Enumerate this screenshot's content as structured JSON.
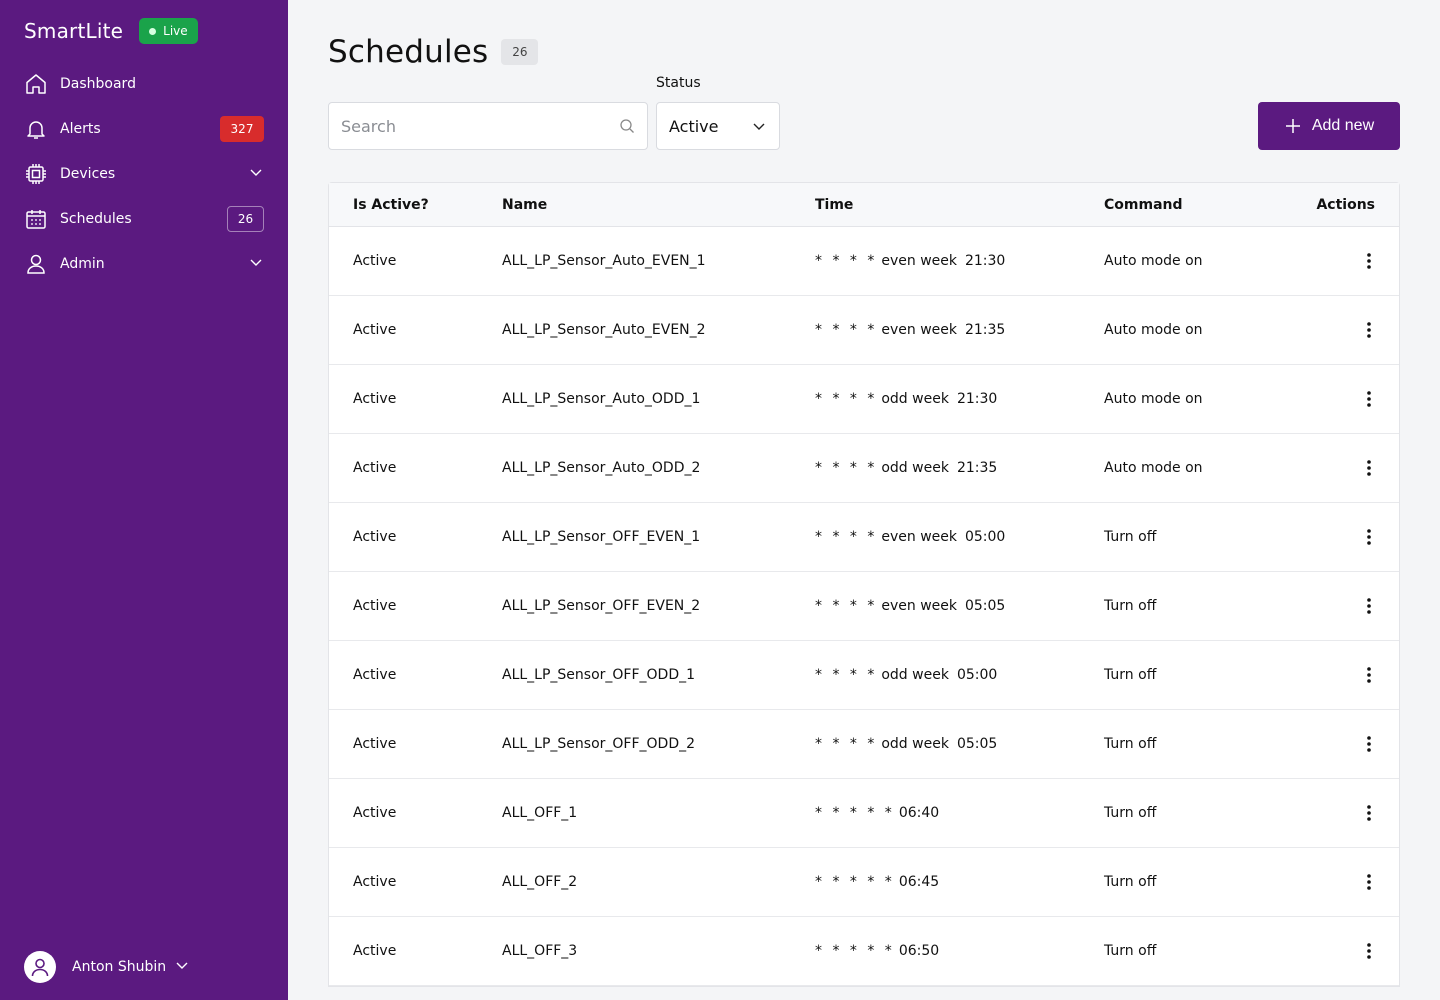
{
  "brand": {
    "name": "SmartLite",
    "live_label": "Live"
  },
  "nav": {
    "items": [
      {
        "label": "Dashboard",
        "icon": "home-icon"
      },
      {
        "label": "Alerts",
        "icon": "bell-icon",
        "badge": "327"
      },
      {
        "label": "Devices",
        "icon": "chip-icon"
      },
      {
        "label": "Schedules",
        "icon": "calendar-icon",
        "badge": "26"
      },
      {
        "label": "Admin",
        "icon": "user-icon"
      }
    ]
  },
  "user": {
    "name": "Anton Shubin"
  },
  "page": {
    "title": "Schedules",
    "count": "26",
    "search_placeholder": "Search",
    "status_label": "Status",
    "status_value": "Active",
    "add_label": "Add new"
  },
  "table": {
    "headers": {
      "active": "Is Active?",
      "name": "Name",
      "time": "Time",
      "command": "Command",
      "actions": "Actions"
    },
    "rows": [
      {
        "active": "Active",
        "name": "ALL_LP_Sensor_Auto_EVEN_1",
        "cron": "* * * *",
        "week": "even week",
        "time": "21:30",
        "command": "Auto mode on"
      },
      {
        "active": "Active",
        "name": "ALL_LP_Sensor_Auto_EVEN_2",
        "cron": "* * * *",
        "week": "even week",
        "time": "21:35",
        "command": "Auto mode on"
      },
      {
        "active": "Active",
        "name": "ALL_LP_Sensor_Auto_ODD_1",
        "cron": "* * * *",
        "week": "odd week",
        "time": "21:30",
        "command": "Auto mode on"
      },
      {
        "active": "Active",
        "name": "ALL_LP_Sensor_Auto_ODD_2",
        "cron": "* * * *",
        "week": "odd week",
        "time": "21:35",
        "command": "Auto mode on"
      },
      {
        "active": "Active",
        "name": "ALL_LP_Sensor_OFF_EVEN_1",
        "cron": "* * * *",
        "week": "even week",
        "time": "05:00",
        "command": "Turn off"
      },
      {
        "active": "Active",
        "name": "ALL_LP_Sensor_OFF_EVEN_2",
        "cron": "* * * *",
        "week": "even week",
        "time": "05:05",
        "command": "Turn off"
      },
      {
        "active": "Active",
        "name": "ALL_LP_Sensor_OFF_ODD_1",
        "cron": "* * * *",
        "week": "odd week",
        "time": "05:00",
        "command": "Turn off"
      },
      {
        "active": "Active",
        "name": "ALL_LP_Sensor_OFF_ODD_2",
        "cron": "* * * *",
        "week": "odd week",
        "time": "05:05",
        "command": "Turn off"
      },
      {
        "active": "Active",
        "name": "ALL_OFF_1",
        "cron": "* * * * *",
        "week": "",
        "time": "06:40",
        "command": "Turn off"
      },
      {
        "active": "Active",
        "name": "ALL_OFF_2",
        "cron": "* * * * *",
        "week": "",
        "time": "06:45",
        "command": "Turn off"
      },
      {
        "active": "Active",
        "name": "ALL_OFF_3",
        "cron": "* * * * *",
        "week": "",
        "time": "06:50",
        "command": "Turn off"
      }
    ]
  },
  "colors": {
    "sidebar": "#5b1a80",
    "live": "#1aa34a",
    "alert": "#d82c2c",
    "background": "#f4f5f7"
  }
}
